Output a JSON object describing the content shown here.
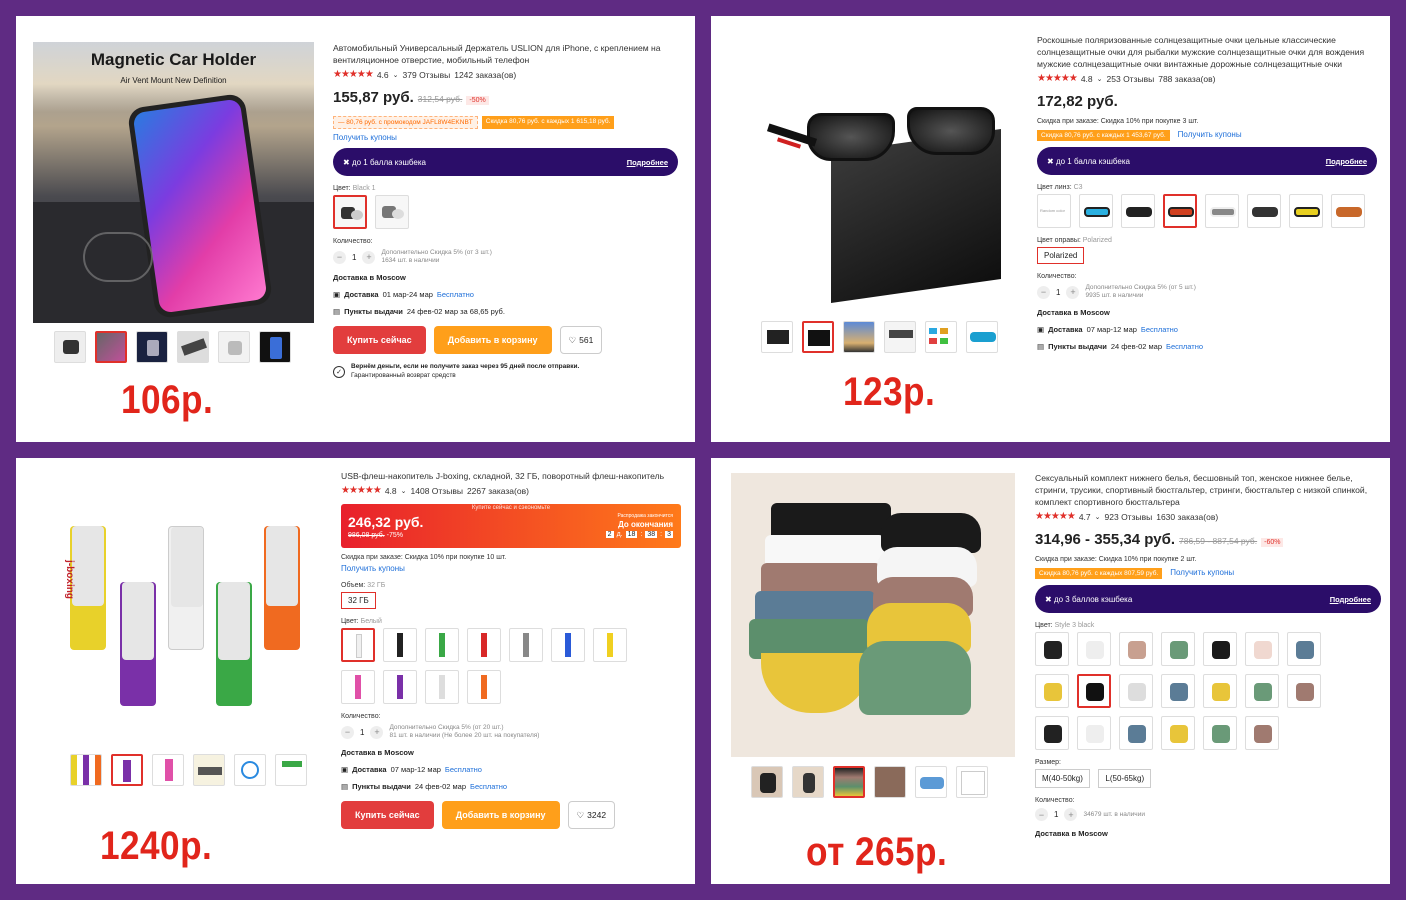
{
  "panels": [
    {
      "big_price": "106р.",
      "image_title": "Magnetic Car Holder",
      "image_sub": "Air Vent Mount New Definition",
      "title": "Автомобильный Универсальный Держатель USLION для iPhone, с креплением на вентиляционное отверстие, мобильный телефон",
      "rating": "4.6",
      "reviews": "379 Отзывы",
      "orders": "1242 заказа(ов)",
      "price": "155,87 руб.",
      "old_price": "312,54 руб.",
      "discount": "-50%",
      "promo1": "— 80,76 руб. с промокодом JAFL8W4EKNBT",
      "promo2": "Скидка 80,76 руб. с каждых 1 615,18 руб.",
      "coupons": "Получить купоны",
      "cashback": "до 1 балла кэшбека",
      "more": "Подробнее",
      "color_label": "Цвет:",
      "color_value": "Black 1",
      "qty_label": "Количество:",
      "qty": "1",
      "qty_note1": "Дополнительно Скидка 5% (от 3 шт.)",
      "qty_note2": "1634 шт. в наличии",
      "delivery_title": "Доставка в Moscow",
      "d1_label": "Доставка",
      "d1_date": "01 мар-24 мар",
      "d1_price": "Бесплатно",
      "d2_label": "Пункты выдачи",
      "d2_date": "24 фев-02 мар за 68,65 руб.",
      "buy": "Купить сейчас",
      "cart": "Добавить в корзину",
      "likes": "561",
      "guarantee1": "Вернём деньги, если не получите заказ через 95 дней после отправки.",
      "guarantee2": "Гарантированный возврат средств"
    },
    {
      "big_price": "123р.",
      "title": "Роскошные поляризованные солнцезащитные очки цельные классические солнцезащитные очки для рыбалки мужские солнцезащитные очки для вождения мужские солнцезащитные очки винтажные дорожные солнцезащитные очки",
      "rating": "4.8",
      "reviews": "253 Отзывы",
      "orders": "788 заказа(ов)",
      "price": "172,82 руб.",
      "order_disc": "Скидка при заказе: Скидка 10% при покупке 3 шт.",
      "promo2": "Скидка 80,76 руб. с каждых 1 453,67 руб.",
      "coupons": "Получить купоны",
      "cashback": "до 1 балла кэшбека",
      "more": "Подробнее",
      "lens_label": "Цвет линз:",
      "lens_value": "C3",
      "random_color": "Random color",
      "frame_label": "Цвет оправы:",
      "frame_value": "Polarized",
      "frame_btn": "Polarized",
      "qty_label": "Количество:",
      "qty": "1",
      "qty_note1": "Дополнительно Скидка 5% (от 5 шт.)",
      "qty_note2": "9935 шт. в наличии",
      "delivery_title": "Доставка в Moscow",
      "d1_label": "Доставка",
      "d1_date": "07 мар-12 мар",
      "d1_price": "Бесплатно",
      "d2_label": "Пункты выдачи",
      "d2_date": "24 фев-02 мар",
      "d2_price": "Бесплатно"
    },
    {
      "big_price": "1240р.",
      "brand": "j-boxing",
      "title": "USB-флеш-накопитель J-boxing, складной, 32 ГБ, поворотный флеш-накопитель",
      "rating": "4.8",
      "reviews": "1408 Отзывы",
      "orders": "2267 заказа(ов)",
      "flash_top": "Купите сейчас и сэкономьте",
      "price": "246,32 руб.",
      "old_price": "986,08 руб.",
      "discount": "-75%",
      "sale_ends": "Распродажа закончится",
      "until_end": "До окончания",
      "t1": "2",
      "t1u": "д.",
      "t2": "18",
      "t3": "38",
      "t4": "3",
      "order_disc": "Скидка при заказе: Скидка 10% при покупке 10 шт.",
      "coupons": "Получить купоны",
      "volume_label": "Объем:",
      "volume_value": "32 ГБ",
      "volume_btn": "32 ГБ",
      "color_label": "Цвет:",
      "color_value": "Белый",
      "qty_label": "Количество:",
      "qty": "1",
      "qty_note1": "Дополнительно Скидка 5% (от 20 шт.)",
      "qty_note2": "81 шт. в наличии (Не более 20 шт. на покупателя)",
      "delivery_title": "Доставка в Moscow",
      "d1_label": "Доставка",
      "d1_date": "07 мар-12 мар",
      "d1_price": "Бесплатно",
      "d2_label": "Пункты выдачи",
      "d2_date": "24 фев-02 мар",
      "d2_price": "Бесплатно",
      "buy": "Купить сейчас",
      "cart": "Добавить в корзину",
      "likes": "3242"
    },
    {
      "big_price": "от 265р.",
      "title": "Сексуальный комплект нижнего белья, бесшовный топ, женское нижнее белье, стринги, трусики, спортивный бюстгальтер, стринги, бюстгальтер с низкой спинкой, комплект спортивного бюстгальтера",
      "rating": "4.7",
      "reviews": "923 Отзывы",
      "orders": "1630 заказа(ов)",
      "price": "314,96 - 355,34 руб.",
      "old_price": "786,59 - 887,54 руб.",
      "discount": "-60%",
      "order_disc": "Скидка при заказе: Скидка 10% при покупке 2 шт.",
      "promo2": "Скидка 80,76 руб. с каждых 807,59 руб.",
      "coupons": "Получить купоны",
      "cashback": "до 3 баллов кэшбека",
      "more": "Подробнее",
      "color_label": "Цвет:",
      "color_value": "Style 3 black",
      "size_label": "Размер:",
      "size1": "M(40-50kg)",
      "size2": "L(50-65kg)",
      "qty_label": "Количество:",
      "qty": "1",
      "qty_note": "34679 шт. в наличии",
      "delivery_title": "Доставка в Moscow"
    }
  ],
  "colors": {
    "accent_red": "#e1251b",
    "cashback_bg": "#2b0d69",
    "frame": "#5f2b83",
    "orange": "#ff9f1a"
  }
}
